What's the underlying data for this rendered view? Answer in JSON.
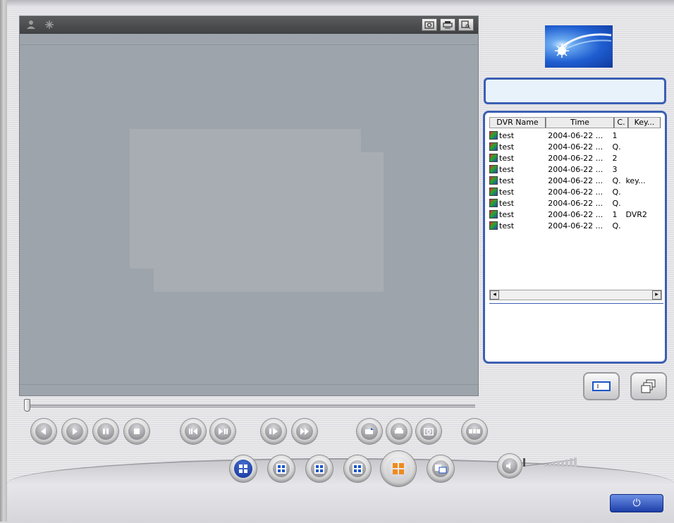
{
  "toolbar": {
    "left_icons": [
      "person-icon",
      "snowflake-icon"
    ],
    "right_icons": [
      "snapshot-icon",
      "print-icon",
      "search-icon"
    ]
  },
  "list": {
    "columns": [
      "DVR Name",
      "Time",
      "C.",
      "Key..."
    ],
    "rows": [
      {
        "name": "test",
        "time": "2004-06-22 ...",
        "ch": "1",
        "key": ""
      },
      {
        "name": "test",
        "time": "2004-06-22 ...",
        "ch": "Q.",
        "key": ""
      },
      {
        "name": "test",
        "time": "2004-06-22 ...",
        "ch": "2",
        "key": ""
      },
      {
        "name": "test",
        "time": "2004-06-22 ...",
        "ch": "3",
        "key": ""
      },
      {
        "name": "test",
        "time": "2004-06-22 ...",
        "ch": "Q.",
        "key": "key..."
      },
      {
        "name": "test",
        "time": "2004-06-22 ...",
        "ch": "Q.",
        "key": ""
      },
      {
        "name": "test",
        "time": "2004-06-22 ...",
        "ch": "Q.",
        "key": ""
      },
      {
        "name": "test",
        "time": "2004-06-22 ...",
        "ch": "1",
        "key": "DVR2"
      },
      {
        "name": "test",
        "time": "2004-06-22 ...",
        "ch": "Q.",
        "key": ""
      }
    ],
    "scroll_left": "◂",
    "scroll_right": "▸"
  },
  "playback_icons": [
    "rewind-icon",
    "play-icon",
    "pause-icon",
    "stop-icon",
    "step-back-icon",
    "step-forward-icon",
    "slow-icon",
    "fast-icon",
    "record-icon",
    "print-icon",
    "snapshot-icon",
    "backup-icon"
  ],
  "layout_icons": [
    "single-view-icon",
    "quad-view-icon",
    "nine-view-icon",
    "sixteen-view-icon",
    "multi-view-icon",
    "sequence-icon"
  ],
  "colors": {
    "accent_blue": "#3c5fb3",
    "video_bg": "#9ea4ab",
    "toolbar_bg": "#4a4c4e"
  },
  "power_label": "⏻"
}
